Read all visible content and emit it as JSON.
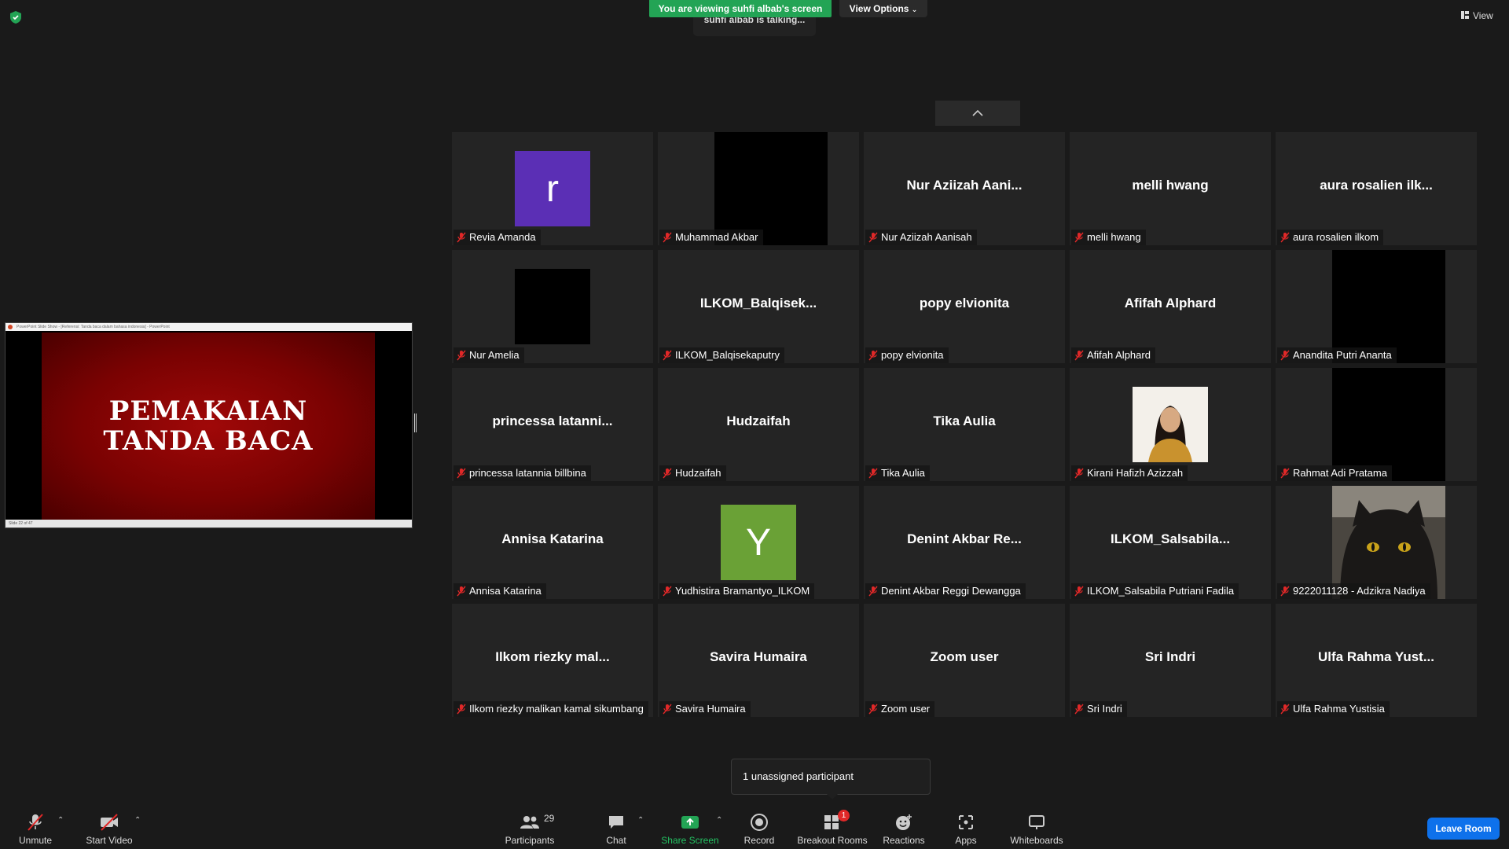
{
  "banner": {
    "viewing_text": "You are viewing suhfi albab's screen",
    "view_options_label": "View Options",
    "talking_text": "suhfi albab is talking...",
    "view_label": "View"
  },
  "shared_screen": {
    "window_title": "PowerPoint Slide Show - [Referensi: Tanda baca dalam bahasa indonesia] - PowerPoint",
    "slide_line1": "PEMAKAIAN",
    "slide_line2": "TANDA BACA",
    "status_text": "Slide 22 of 47"
  },
  "participants": [
    {
      "big": "",
      "label": "Revia Amanda",
      "avatar": "r",
      "avatar_color": "#5b2fb5"
    },
    {
      "big": "",
      "label": "Muhammad Akbar",
      "video": "black-wide"
    },
    {
      "big": "Nur Aziizah Aani...",
      "label": "Nur Aziizah Aanisah"
    },
    {
      "big": "melli hwang",
      "label": "melli hwang"
    },
    {
      "big": "aura rosalien ilk...",
      "label": "aura rosalien ilkom"
    },
    {
      "big": "",
      "label": "Nur Amelia",
      "video": "black-square"
    },
    {
      "big": "ILKOM_Balqisek...",
      "label": "ILKOM_Balqisekaputry"
    },
    {
      "big": "popy elvionita",
      "label": "popy elvionita"
    },
    {
      "big": "Afifah Alphard",
      "label": "Afifah Alphard"
    },
    {
      "big": "",
      "label": "Anandita Putri Ananta",
      "video": "black-wide"
    },
    {
      "big": "princessa latanni...",
      "label": "princessa latannia billbina"
    },
    {
      "big": "Hudzaifah",
      "label": "Hudzaifah"
    },
    {
      "big": "Tika Aulia",
      "label": "Tika Aulia"
    },
    {
      "big": "",
      "label": "Kirani Hafizh Azizzah",
      "video": "photo-person"
    },
    {
      "big": "",
      "label": "Rahmat Adi Pratama",
      "video": "black-wide"
    },
    {
      "big": "Annisa Katarina",
      "label": "Annisa Katarina"
    },
    {
      "big": "",
      "label": "Yudhistira Bramantyo_ILKOM",
      "avatar": "Y",
      "avatar_color": "#6aa136"
    },
    {
      "big": "Denint Akbar Re...",
      "label": "Denint Akbar Reggi Dewangga"
    },
    {
      "big": "ILKOM_Salsabila...",
      "label": "ILKOM_Salsabila Putriani Fadila"
    },
    {
      "big": "",
      "label": "9222011128 - Adzikra Nadiya",
      "video": "photo-cat"
    },
    {
      "big": "Ilkom riezky mal...",
      "label": "Ilkom riezky malikan kamal sikumbang"
    },
    {
      "big": "Savira Humaira",
      "label": "Savira Humaira"
    },
    {
      "big": "Zoom user",
      "label": "Zoom user"
    },
    {
      "big": "Sri Indri",
      "label": "Sri Indri"
    },
    {
      "big": "Ulfa Rahma Yust...",
      "label": "Ulfa Rahma Yustisia"
    }
  ],
  "tooltip": {
    "text": "1 unassigned participant"
  },
  "toolbar": {
    "unmute": "Unmute",
    "start_video": "Start Video",
    "participants": "Participants",
    "participants_count": "29",
    "chat": "Chat",
    "share_screen": "Share Screen",
    "record": "Record",
    "breakout_rooms": "Breakout Rooms",
    "breakout_badge": "1",
    "reactions": "Reactions",
    "apps": "Apps",
    "whiteboards": "Whiteboards",
    "leave": "Leave Room"
  },
  "colors": {
    "green": "#23a455",
    "blue": "#0e71eb",
    "red": "#e02828"
  }
}
